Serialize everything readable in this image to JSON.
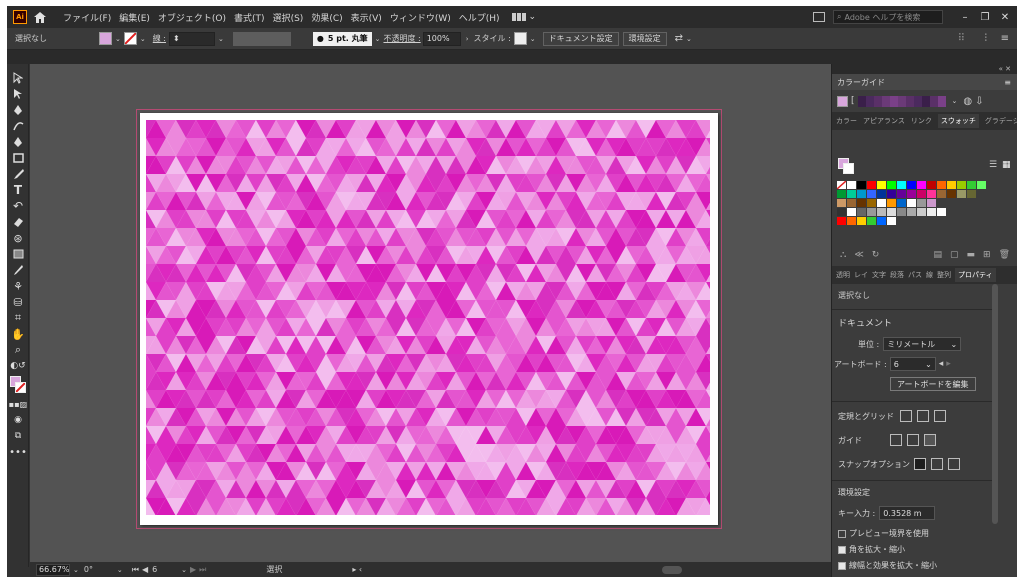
{
  "menubar": {
    "logo": "Ai",
    "items": [
      "ファイル(F)",
      "編集(E)",
      "オブジェクト(O)",
      "書式(T)",
      "選択(S)",
      "効果(C)",
      "表示(V)",
      "ウィンドウ(W)",
      "ヘルプ(H)"
    ],
    "search_placeholder": "Adobe ヘルプを検索"
  },
  "controlbar": {
    "selection": "選択なし",
    "stroke_label": "線 :",
    "brush": "5 pt. 丸筆",
    "opacity_label": "不透明度 :",
    "opacity_value": "100%",
    "style_label": "スタイル :",
    "doc_setup": "ドキュメント設定",
    "preferences": "環境設定"
  },
  "statusbar": {
    "zoom": "66.67%",
    "rotation": "0°",
    "artboard": "6",
    "tool": "選択"
  },
  "panel": {
    "color_guide_title": "カラーガイド",
    "swatch_tabs": [
      "カラー",
      "アピアランス",
      "リンク",
      "スウォッチ",
      "グラデーション"
    ],
    "prop_tabs": [
      "透明",
      "レイ",
      "文字",
      "段落",
      "パス",
      "線",
      "整列",
      "プロパティ"
    ],
    "selection": "選択なし",
    "document_heading": "ドキュメント",
    "units_label": "単位 :",
    "units_value": "ミリメートル",
    "artboard_label": "アートボード :",
    "artboard_value": "6",
    "edit_artboards": "アートボードを編集",
    "rulers_grid": "定規とグリッド",
    "guides": "ガイド",
    "snap": "スナップオプション",
    "prefs_heading": "環境設定",
    "key_increment_label": "キー入力 :",
    "key_increment_value": "0.3528 m",
    "chk_preview": "プレビュー境界を使用",
    "chk_corners": "角を拡大・縮小",
    "chk_effects": "線幅と効果を拡大・縮小"
  },
  "colors": {
    "fill": "#d8a6dc",
    "stroke": "#e0307a",
    "pattern_base": "#e040c8",
    "pattern_dark": "#d81ab8",
    "pattern_light": "#f0a8e8"
  }
}
